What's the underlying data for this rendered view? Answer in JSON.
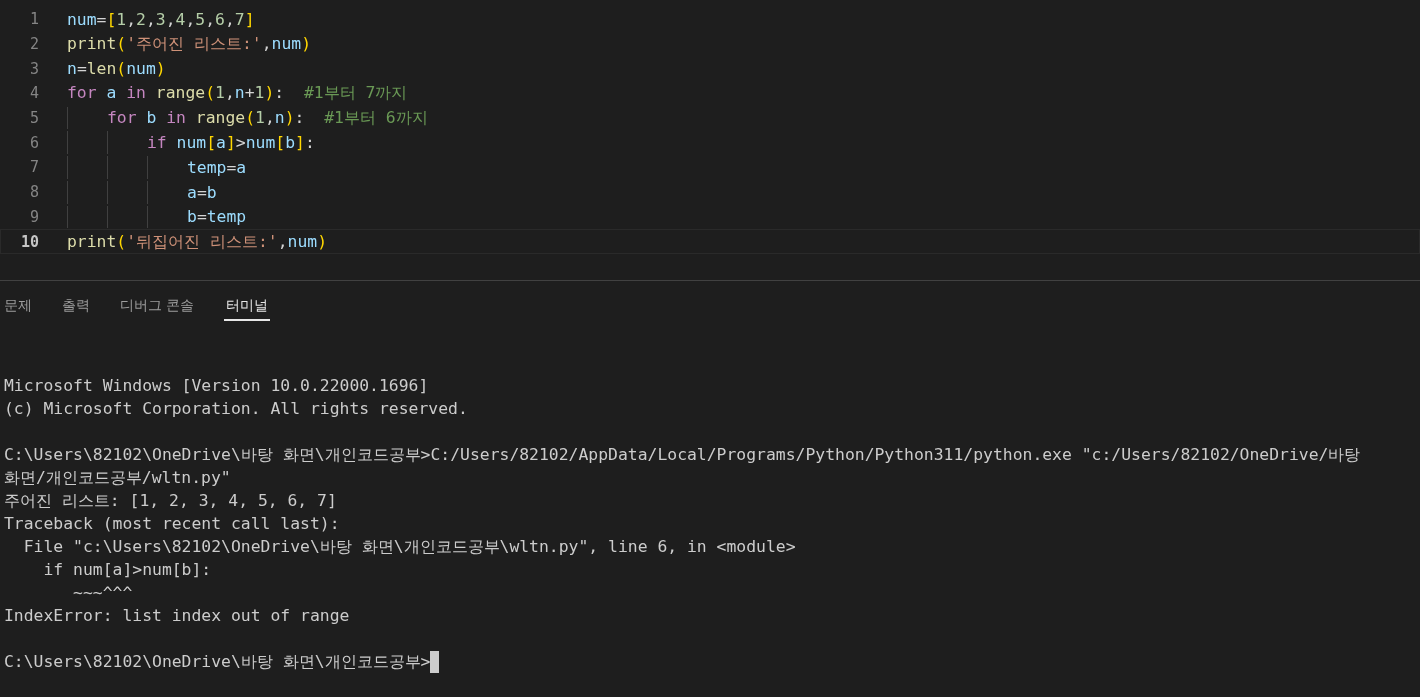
{
  "editor": {
    "lines": [
      {
        "number": "1",
        "current": false,
        "tokens": [
          {
            "kind": "var",
            "text": "num"
          },
          {
            "kind": "op",
            "text": "="
          },
          {
            "kind": "bracket",
            "text": "["
          },
          {
            "kind": "num",
            "text": "1"
          },
          {
            "kind": "op",
            "text": ","
          },
          {
            "kind": "num",
            "text": "2"
          },
          {
            "kind": "op",
            "text": ","
          },
          {
            "kind": "num",
            "text": "3"
          },
          {
            "kind": "op",
            "text": ","
          },
          {
            "kind": "num",
            "text": "4"
          },
          {
            "kind": "op",
            "text": ","
          },
          {
            "kind": "num",
            "text": "5"
          },
          {
            "kind": "op",
            "text": ","
          },
          {
            "kind": "num",
            "text": "6"
          },
          {
            "kind": "op",
            "text": ","
          },
          {
            "kind": "num",
            "text": "7"
          },
          {
            "kind": "bracket",
            "text": "]"
          }
        ]
      },
      {
        "number": "2",
        "current": false,
        "tokens": [
          {
            "kind": "func",
            "text": "print"
          },
          {
            "kind": "bracket",
            "text": "("
          },
          {
            "kind": "str",
            "text": "'주어진 리스트:'"
          },
          {
            "kind": "op",
            "text": ","
          },
          {
            "kind": "var",
            "text": "num"
          },
          {
            "kind": "bracket",
            "text": ")"
          }
        ]
      },
      {
        "number": "3",
        "current": false,
        "tokens": [
          {
            "kind": "var",
            "text": "n"
          },
          {
            "kind": "op",
            "text": "="
          },
          {
            "kind": "func",
            "text": "len"
          },
          {
            "kind": "bracket",
            "text": "("
          },
          {
            "kind": "var",
            "text": "num"
          },
          {
            "kind": "bracket",
            "text": ")"
          }
        ]
      },
      {
        "number": "4",
        "current": false,
        "tokens": [
          {
            "kind": "keyword",
            "text": "for "
          },
          {
            "kind": "var",
            "text": "a "
          },
          {
            "kind": "keyword",
            "text": "in "
          },
          {
            "kind": "func",
            "text": "range"
          },
          {
            "kind": "bracket",
            "text": "("
          },
          {
            "kind": "num",
            "text": "1"
          },
          {
            "kind": "op",
            "text": ","
          },
          {
            "kind": "var",
            "text": "n"
          },
          {
            "kind": "op",
            "text": "+"
          },
          {
            "kind": "num",
            "text": "1"
          },
          {
            "kind": "bracket",
            "text": ")"
          },
          {
            "kind": "op",
            "text": ":  "
          },
          {
            "kind": "comment",
            "text": "#1부터 7까지"
          }
        ],
        "children": [
          {
            "number": "5",
            "current": false,
            "tokens": [
              {
                "kind": "keyword",
                "text": "for "
              },
              {
                "kind": "var",
                "text": "b "
              },
              {
                "kind": "keyword",
                "text": "in "
              },
              {
                "kind": "func",
                "text": "range"
              },
              {
                "kind": "bracket",
                "text": "("
              },
              {
                "kind": "num",
                "text": "1"
              },
              {
                "kind": "op",
                "text": ","
              },
              {
                "kind": "var",
                "text": "n"
              },
              {
                "kind": "bracket",
                "text": ")"
              },
              {
                "kind": "op",
                "text": ":  "
              },
              {
                "kind": "comment",
                "text": "#1부터 6까지"
              }
            ],
            "children": [
              {
                "number": "6",
                "current": false,
                "tokens": [
                  {
                    "kind": "keyword",
                    "text": "if "
                  },
                  {
                    "kind": "var",
                    "text": "num"
                  },
                  {
                    "kind": "bracket",
                    "text": "["
                  },
                  {
                    "kind": "var",
                    "text": "a"
                  },
                  {
                    "kind": "bracket",
                    "text": "]"
                  },
                  {
                    "kind": "op",
                    "text": ">"
                  },
                  {
                    "kind": "var",
                    "text": "num"
                  },
                  {
                    "kind": "bracket",
                    "text": "["
                  },
                  {
                    "kind": "var",
                    "text": "b"
                  },
                  {
                    "kind": "bracket",
                    "text": "]"
                  },
                  {
                    "kind": "op",
                    "text": ":"
                  }
                ],
                "children": [
                  {
                    "number": "7",
                    "current": false,
                    "tokens": [
                      {
                        "kind": "var",
                        "text": "temp"
                      },
                      {
                        "kind": "op",
                        "text": "="
                      },
                      {
                        "kind": "var",
                        "text": "a"
                      }
                    ]
                  },
                  {
                    "number": "8",
                    "current": false,
                    "tokens": [
                      {
                        "kind": "var",
                        "text": "a"
                      },
                      {
                        "kind": "op",
                        "text": "="
                      },
                      {
                        "kind": "var",
                        "text": "b"
                      }
                    ]
                  },
                  {
                    "number": "9",
                    "current": false,
                    "tokens": [
                      {
                        "kind": "var",
                        "text": "b"
                      },
                      {
                        "kind": "op",
                        "text": "="
                      },
                      {
                        "kind": "var",
                        "text": "temp"
                      }
                    ]
                  }
                ]
              }
            ]
          }
        ]
      },
      {
        "number": "10",
        "current": true,
        "tokens": [
          {
            "kind": "func",
            "text": "print"
          },
          {
            "kind": "bracket",
            "text": "("
          },
          {
            "kind": "str",
            "text": "'뒤집어진 리스트:'"
          },
          {
            "kind": "op",
            "text": ","
          },
          {
            "kind": "var",
            "text": "num"
          },
          {
            "kind": "bracket",
            "text": ")"
          }
        ]
      }
    ]
  },
  "panel": {
    "tabs": [
      {
        "label": "문제",
        "selected": false
      },
      {
        "label": "출력",
        "selected": false
      },
      {
        "label": "디버그 콘솔",
        "selected": false
      },
      {
        "label": "터미널",
        "selected": true
      }
    ],
    "terminal": {
      "blocks": [
        [
          "Microsoft Windows [Version 10.0.22000.1696]",
          "(c) Microsoft Corporation. All rights reserved."
        ],
        [
          "C:\\Users\\82102\\OneDrive\\바탕 화면\\개인코드공부>C:/Users/82102/AppData/Local/Programs/Python/Python311/python.exe \"c:/Users/82102/OneDrive/바탕",
          "화면/개인코드공부/wltn.py\"",
          "주어진 리스트: [1, 2, 3, 4, 5, 6, 7]",
          "Traceback (most recent call last):",
          "  File \"c:\\Users\\82102\\OneDrive\\바탕 화면\\개인코드공부\\wltn.py\", line 6, in <module>",
          "    if num[a]>num[b]:",
          "       ~~~^^^",
          "IndexError: list index out of range"
        ]
      ],
      "prompt": "C:\\Users\\82102\\OneDrive\\바탕 화면\\개인코드공부>"
    }
  }
}
